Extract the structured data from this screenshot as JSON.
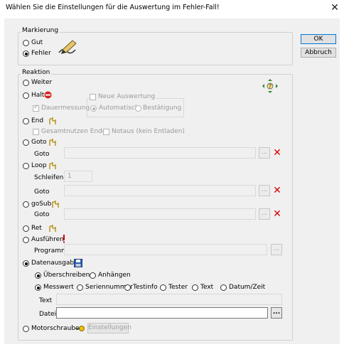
{
  "window": {
    "title": "Wählen Sie die Einstellungen für die Auswertung im Fehler-Fall!",
    "close_glyph": "✕"
  },
  "buttons": {
    "ok": "OK",
    "cancel": "Abbruch",
    "einstellungen": "Einstellungen"
  },
  "markierung": {
    "title": "Markierung",
    "gut": "Gut",
    "fehler": "Fehler",
    "selected": "Fehler"
  },
  "reaktion": {
    "title": "Reaktion",
    "weiter": "Weiter",
    "halt": "Halt",
    "dauermessung": "Dauermessung",
    "neue_auswertung": "Neue Auswertung",
    "automatisch": "Automatisch",
    "bestaetigung": "Bestätigung",
    "end": "End",
    "gesamtnutzen_ende": "Gesamtnutzen Ende",
    "notaus": "Notaus (kein Entladen)",
    "goto": "Goto",
    "goto_label": "Goto",
    "loop": "Loop",
    "schleifen_label": "Schleifen",
    "schleifen_value": "1",
    "loop_goto_label": "Goto",
    "gosub": "goSub",
    "gosub_goto_label": "Goto",
    "ret": "Ret",
    "ausfuehren": "Ausführen",
    "programm_label": "Programm",
    "datenausgabe": "Datenausgabe",
    "ueberschreiben": "Überschreiben",
    "anhaengen": "Anhängen",
    "messwert": "Messwert",
    "seriennummer": "Seriennummer",
    "testinfo": "Testinfo",
    "tester": "Tester",
    "text": "Text",
    "datum_zeit": "Datum/Zeit",
    "text_label": "Text",
    "datei_label": "Datei",
    "motorschrauber": "Motorschrauber",
    "selected": "Datenausgabe"
  },
  "browse": "...",
  "delete": "✕",
  "colors": {
    "accent": "#0078d7",
    "delete_red": "#d40000",
    "stop_red": "#d82020",
    "save_blue": "#2a5db0"
  }
}
